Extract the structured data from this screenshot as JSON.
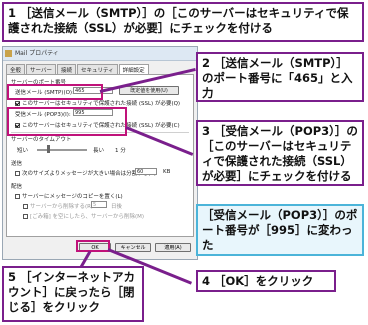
{
  "callouts": {
    "c1": {
      "num": "1",
      "text": "［送信メール（SMTP）］の［このサーバーはセキュリティで保護された接続（SSL）が必要］にチェックを付ける"
    },
    "c2": {
      "num": "2",
      "text": "［送信メール（SMTP）］のポート番号に「465」と入力"
    },
    "c3": {
      "num": "3",
      "text": "［受信メール（POP3）］の［このサーバーはセキュリティで保護された接続（SSL）が必要］にチェックを付ける"
    },
    "c4": {
      "num": "4",
      "text": "［OK］をクリック"
    },
    "c5": {
      "num": "5",
      "text": "［インターネットアカウント］に戻ったら［閉じる］をクリック"
    },
    "note": {
      "text": "［受信メール（POP3）］のポート番号が［995］に変わった"
    }
  },
  "dialog": {
    "title": "Mail プロパティ",
    "tabs": [
      "全般",
      "サーバー",
      "接続",
      "セキュリティ",
      "詳細設定"
    ],
    "active_tab": "詳細設定",
    "server_port_heading": "サーバーのポート番号",
    "smtp_label": "送信メール (SMTP)(O):",
    "smtp_port": "465",
    "defaults_button": "既定値を使用(U)",
    "smtp_ssl_label": "このサーバーはセキュリティで保護された接続 (SSL) が必要(Q)",
    "pop3_label": "受信メール (POP3)(I):",
    "pop3_port": "995",
    "pop3_ssl_label": "このサーバーはセキュリティで保護された接続 (SSL) が必要(C)",
    "timeout_heading": "サーバーのタイムアウト",
    "timeout_short": "短い",
    "timeout_long": "長い",
    "timeout_value": "1 分",
    "sending_heading": "送信",
    "split_label": "次のサイズよりメッセージが大きい場合は分割する(B)",
    "split_value": "60",
    "split_unit": "KB",
    "delivery_heading": "配信",
    "leave_copy_label": "サーバーにメッセージのコピーを置く(L)",
    "remove_after_label": "サーバーから削除する(R)",
    "remove_days": "5",
    "remove_days_unit": "日後",
    "remove_deleted_label": "[ごみ箱] を空にしたら、サーバーから削除(M)",
    "ok_button": "OK",
    "cancel_button": "キャンセル",
    "apply_button": "適用(A)"
  }
}
